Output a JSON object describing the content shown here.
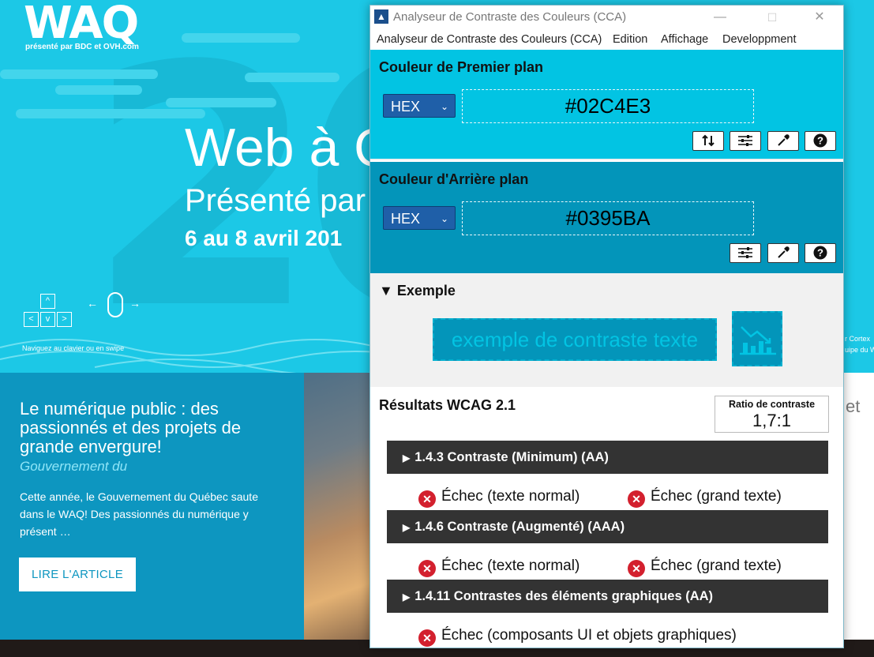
{
  "site": {
    "logo": "WAQ",
    "logo_sub": "présenté par BDC et OVH.com",
    "hero_title": "Web à Q",
    "hero_sub": "Présenté par",
    "hero_date": "6 au 8 avril 201",
    "nav_hint": "Naviguez au clavier ou en swipe",
    "corner_text_1": "r Cortex",
    "corner_text_2": "uipe du W",
    "article_title": "Le numérique public : des passionnés et des projets de grande envergure!",
    "article_dept": "Gouvernement du",
    "article_body": "Cette année, le Gouvernement du Québec saute dans le WAQ! Des passionnés du numérique y présent …",
    "read_button": "LIRE L'ARTICLE",
    "et_text": "et"
  },
  "window": {
    "title": "Analyseur de Contraste des Couleurs (CCA)",
    "controls": {
      "minimize": "—",
      "maximize": "☐",
      "close": "✕"
    },
    "menu": [
      "Analyseur de Contraste des Couleurs (CCA)",
      "Edition",
      "Affichage",
      "Developpment"
    ]
  },
  "foreground": {
    "title": "Couleur de Premier plan",
    "format": "HEX",
    "value": "#02C4E3",
    "color": "#02c4e3",
    "buttons": [
      "swap-icon",
      "sliders-icon",
      "eyedropper-icon",
      "help-icon"
    ]
  },
  "background": {
    "title": "Couleur d'Arrière plan",
    "format": "HEX",
    "value": "#0395BA",
    "color": "#0395ba",
    "buttons": [
      "sliders-icon",
      "eyedropper-icon",
      "help-icon"
    ]
  },
  "example": {
    "title": "Exemple",
    "sample_text": "exemple de contraste texte",
    "sample_icon": "chart-icon"
  },
  "results": {
    "title": "Résultats WCAG 2.1",
    "ratio_label": "Ratio de contraste",
    "ratio_value": "1,7:1",
    "fail_color": "#d3202e",
    "criteria": [
      {
        "label": "1.4.3 Contraste (Minimum) (AA)",
        "items": [
          "Échec (texte normal)",
          "Échec (grand texte)"
        ]
      },
      {
        "label": "1.4.6 Contraste (Augmenté) (AAA)",
        "items": [
          "Échec (texte normal)",
          "Échec (grand texte)"
        ]
      },
      {
        "label": "1.4.11 Contrastes des éléments graphiques (AA)",
        "items": [
          "Échec (composants UI et objets graphiques)"
        ]
      }
    ]
  }
}
